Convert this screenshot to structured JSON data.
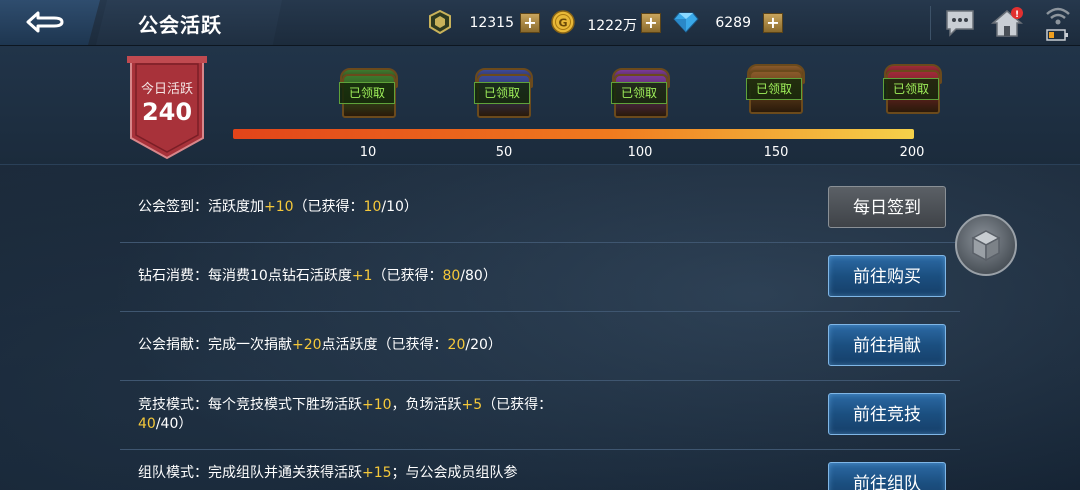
{
  "topbar": {
    "title": "公会活跃",
    "currencies": [
      {
        "icon": "guild-emblem-icon",
        "value": "12315",
        "plus": "+"
      },
      {
        "icon": "gold-coin-icon",
        "value": "1222万",
        "plus": "+"
      },
      {
        "icon": "diamond-icon",
        "value": "6289",
        "plus": "+"
      }
    ]
  },
  "activity": {
    "banner_label": "今日活跃",
    "banner_value": "240",
    "progress_fraction": 1.0,
    "chests": [
      {
        "label": "已领取",
        "milestone": "10",
        "color": "#3c7a2e"
      },
      {
        "label": "已领取",
        "milestone": "50",
        "color": "#3b4a9a"
      },
      {
        "label": "已领取",
        "milestone": "100",
        "color": "#7a3a9a"
      },
      {
        "label": "已领取",
        "milestone": "150",
        "color": "#8a5a2a"
      },
      {
        "label": "已领取",
        "milestone": "200",
        "color": "#a02a3a"
      }
    ]
  },
  "tasks": [
    {
      "parts": [
        "公会签到：活跃度加",
        "+10",
        "（已获得：",
        "10",
        "/10）"
      ],
      "button": "每日签到",
      "button_style": "gray"
    },
    {
      "parts": [
        "钻石消费：每消费10点钻石活跃度",
        "+1",
        "（已获得：",
        "80",
        "/80）"
      ],
      "button": "前往购买",
      "button_style": "blue"
    },
    {
      "parts": [
        "公会捐献：完成一次捐献",
        "+20",
        "点活跃度（已获得：",
        "20",
        "/20）"
      ],
      "button": "前往捐献",
      "button_style": "blue"
    },
    {
      "parts": [
        "竞技模式：每个竞技模式下胜场活跃",
        "+10",
        "，负场活跃",
        "+5",
        "（已获得：",
        "40",
        "/40）"
      ],
      "button": "前往竞技",
      "button_style": "blue"
    },
    {
      "parts": [
        "组队模式：完成组队并通关获得活跃",
        "+15",
        "；与公会成员组队参"
      ],
      "button": "前往组队",
      "button_style": "blue"
    }
  ],
  "colors": {
    "accent_yellow": "#f5c83a",
    "button_blue": "#1b4f80",
    "progress_orange": "#f07a1e",
    "banner_red": "#a8323a",
    "claimed_green": "#9ff05a"
  }
}
